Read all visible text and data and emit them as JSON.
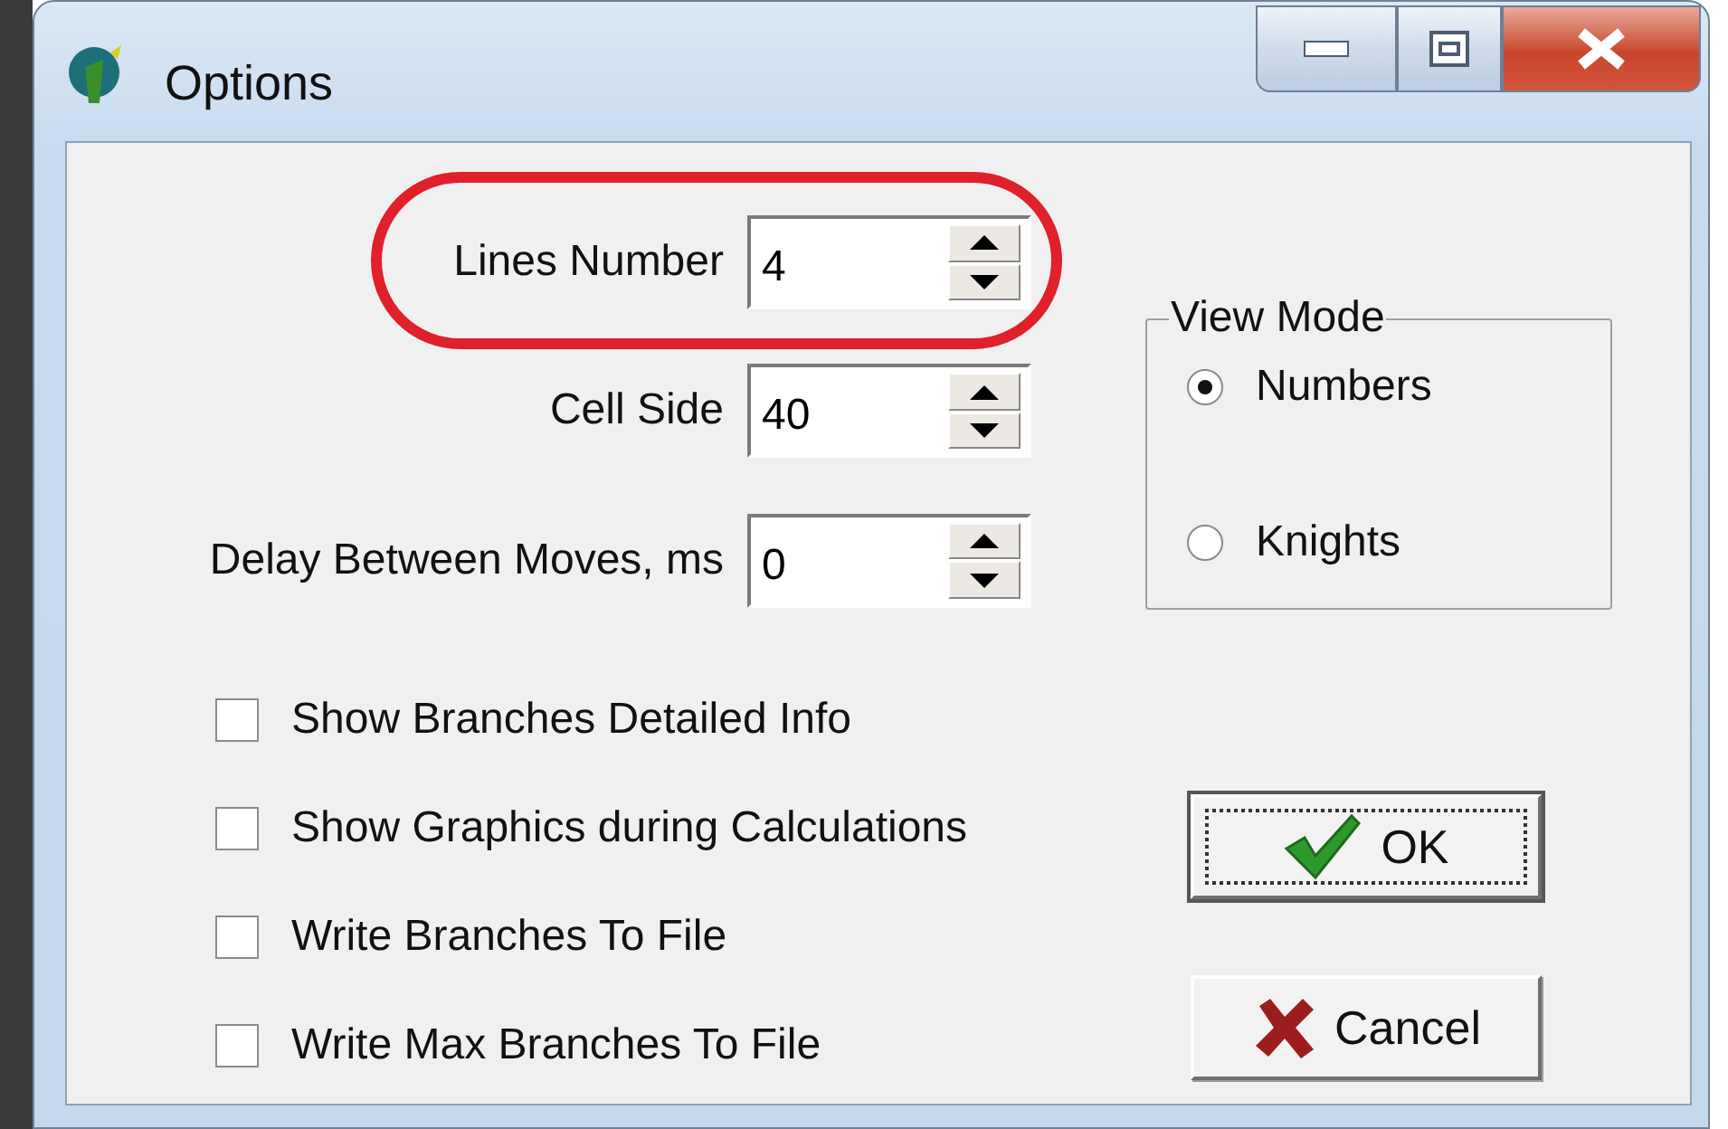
{
  "window": {
    "title": "Options"
  },
  "fields": [
    {
      "label": "Lines Number",
      "value": "4",
      "highlighted": true
    },
    {
      "label": "Cell Side",
      "value": "40",
      "highlighted": false
    },
    {
      "label": "Delay Between Moves, ms",
      "value": "0",
      "highlighted": false
    }
  ],
  "view_mode": {
    "title": "View Mode",
    "options": [
      {
        "label": "Numbers",
        "selected": true
      },
      {
        "label": "Knights",
        "selected": false
      }
    ]
  },
  "checkboxes": [
    {
      "label": "Show Branches Detailed Info",
      "checked": false
    },
    {
      "label": "Show Graphics during Calculations",
      "checked": false
    },
    {
      "label": "Write Branches To File",
      "checked": false
    },
    {
      "label": "Write Max Branches To File",
      "checked": false
    }
  ],
  "buttons": [
    {
      "label": "OK",
      "kind": "ok",
      "focused": true
    },
    {
      "label": "Cancel",
      "kind": "cancel",
      "focused": false
    }
  ]
}
